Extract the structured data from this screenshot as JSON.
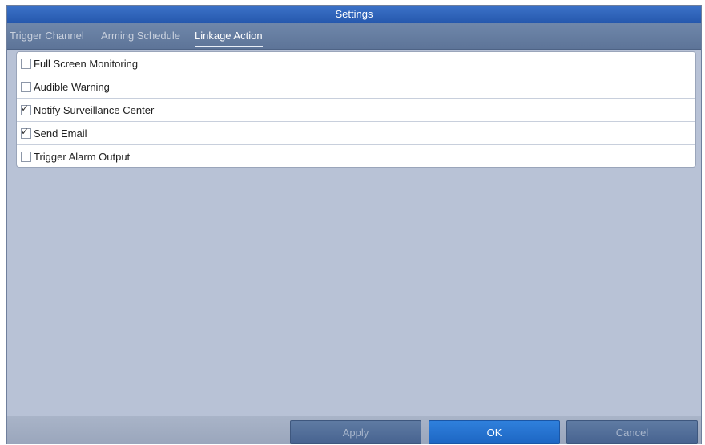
{
  "window": {
    "title": "Settings"
  },
  "tabs": [
    {
      "label": "Trigger Channel",
      "active": false
    },
    {
      "label": "Arming Schedule",
      "active": false
    },
    {
      "label": "Linkage Action",
      "active": true
    }
  ],
  "linkage_actions": [
    {
      "label": "Full Screen Monitoring",
      "checked": false
    },
    {
      "label": "Audible Warning",
      "checked": false
    },
    {
      "label": "Notify Surveillance Center",
      "checked": true
    },
    {
      "label": "Send Email",
      "checked": true
    },
    {
      "label": "Trigger Alarm Output",
      "checked": false
    }
  ],
  "buttons": {
    "apply": "Apply",
    "ok": "OK",
    "cancel": "Cancel"
  },
  "tick_glyph": "✓",
  "colors": {
    "titlebar": "#2f67c0",
    "background": "#b8c2d6",
    "primary_button": "#2474d1"
  }
}
